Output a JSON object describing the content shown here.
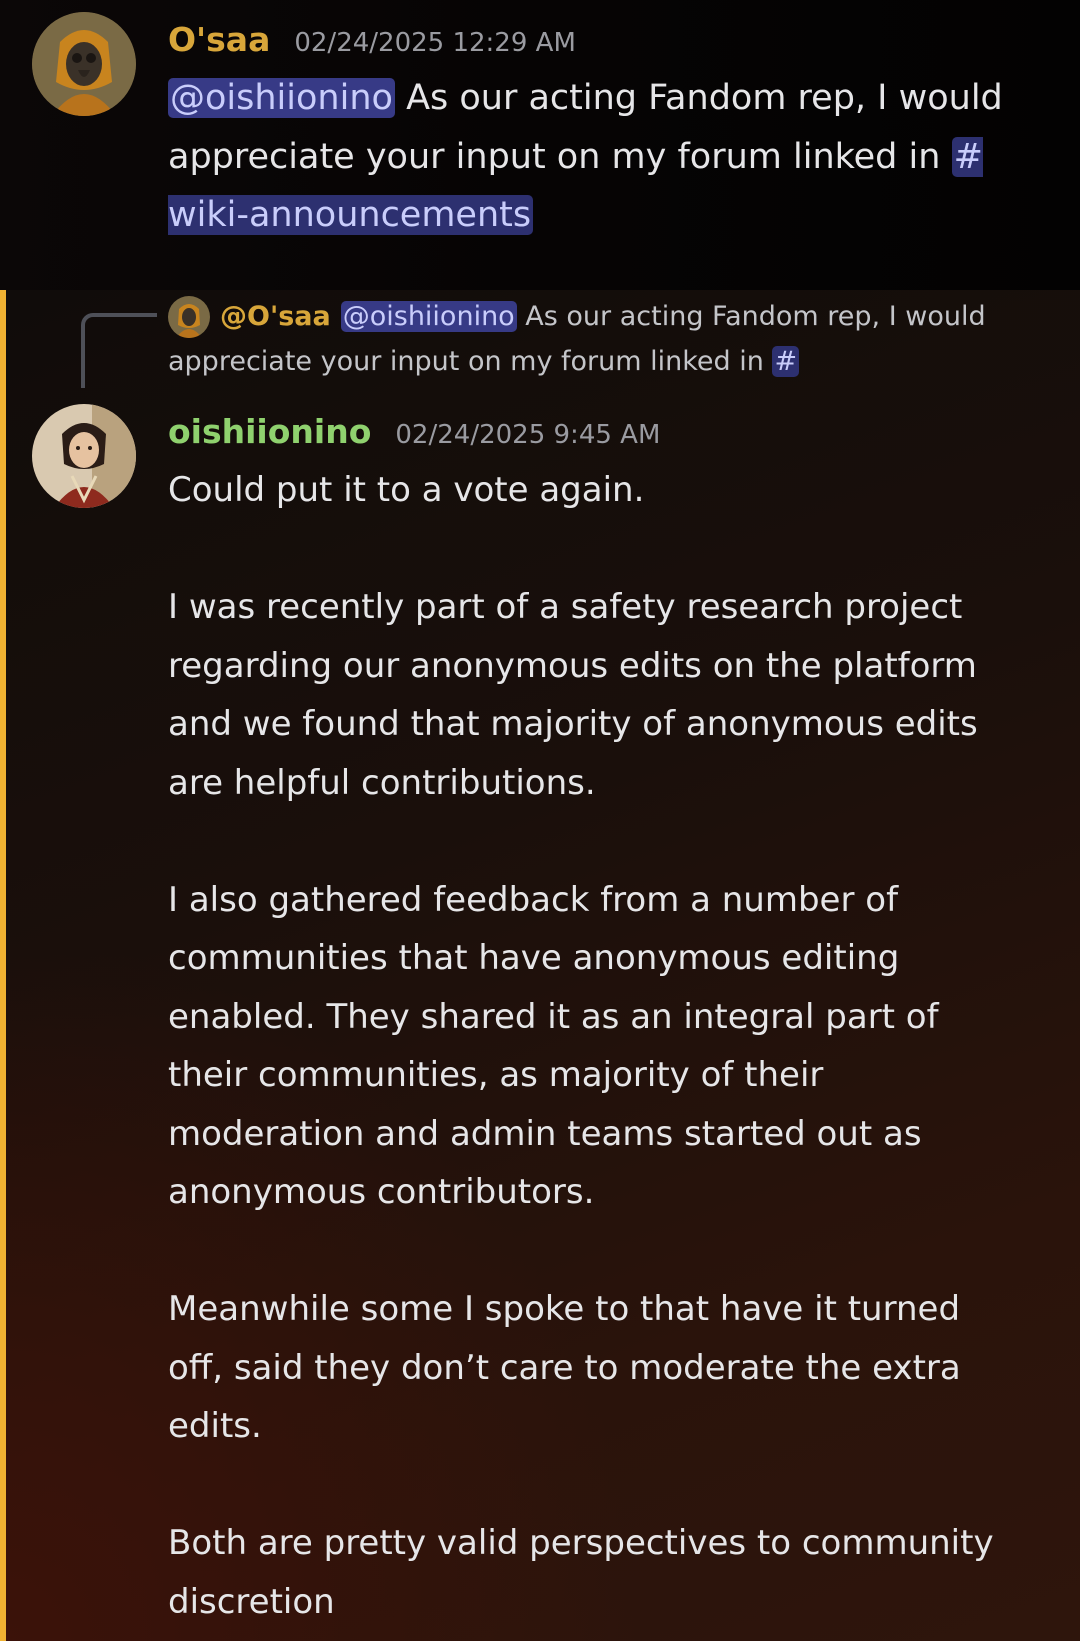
{
  "messages": {
    "first": {
      "author": "O'saa",
      "timestamp": "02/24/2025 12:29 AM",
      "mention": "@oishiionino",
      "text": "As our acting Fandom rep, I would appreciate your input on my forum linked in",
      "channel_hash": "#",
      "channel_name": "wiki-announcements",
      "author_color": "#d8a63a"
    },
    "reply_ref": {
      "author": "@O'saa",
      "mention": "@oishiionino",
      "text_line1": "As our acting Fandom rep, I would",
      "text_line2": "appreciate your input on my forum linked in",
      "channel_hash": "#"
    },
    "second": {
      "author": "oishiionino",
      "timestamp": "02/24/2025 9:45 AM",
      "author_color": "#8fd16e",
      "highlight_color": "#f0b232",
      "paragraphs": [
        [
          "Could put it to a vote again."
        ],
        [
          "I was recently part of a safety research project",
          "regarding our anonymous edits on the platform",
          "and we found that majority of anonymous edits",
          "are helpful contributions."
        ],
        [
          "I also gathered feedback from a number of",
          "communities that have anonymous editing",
          "enabled. They shared it as an integral part of",
          "their communities, as majority of their",
          "moderation and admin teams started out as",
          "anonymous contributors."
        ],
        [
          "Meanwhile some I spoke to that have it turned",
          "off, said they don’t care to moderate the extra",
          "edits."
        ],
        [
          "Both are pretty valid perspectives to community",
          "discretion"
        ]
      ]
    }
  },
  "icons": {
    "osaa_avatar": "plague-doctor-avatar",
    "oishi_avatar": "character-portrait-avatar"
  }
}
